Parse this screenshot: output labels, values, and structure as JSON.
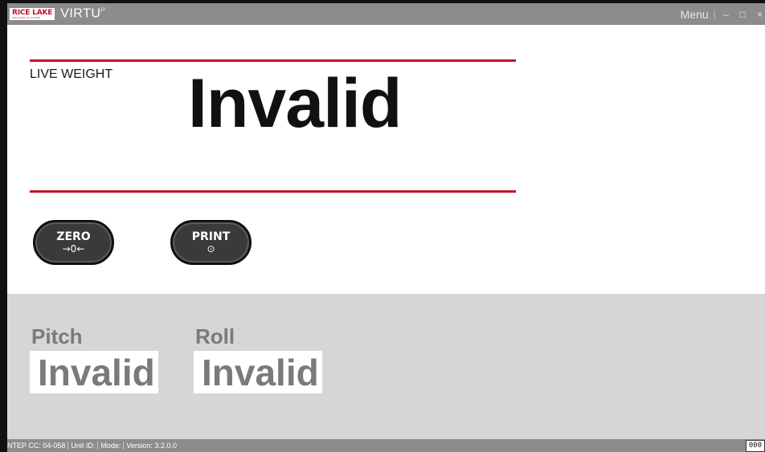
{
  "titlebar": {
    "brand": "RICE LAKE",
    "brand_sub": "WEIGHING SYSTEMS",
    "app_name": "VIRTU",
    "app_suffix": "i³",
    "menu_label": "Menu",
    "separator": "|",
    "minimize": "–",
    "maximize": "□",
    "close": "×"
  },
  "weight": {
    "label": "LIVE WEIGHT",
    "value": "Invalid"
  },
  "buttons": {
    "zero": {
      "label": "ZERO",
      "symbol": "→0←"
    },
    "print": {
      "label": "PRINT",
      "symbol": "⊙"
    }
  },
  "tilt": {
    "pitch": {
      "label": "Pitch",
      "value": "Invalid"
    },
    "roll": {
      "label": "Roll",
      "value": "Invalid"
    }
  },
  "status": {
    "ntep": "NTEP CC: 04-058",
    "unit_id": "Unit ID:",
    "mode": "Mode:",
    "version": "Version: 3.2.0.0",
    "counter": "000"
  },
  "colors": {
    "accent_red": "#c8102e",
    "titlebar_gray": "#8c8c8c",
    "tilt_panel_gray": "#d6d6d6",
    "button_dark": "#3a3a3a"
  }
}
